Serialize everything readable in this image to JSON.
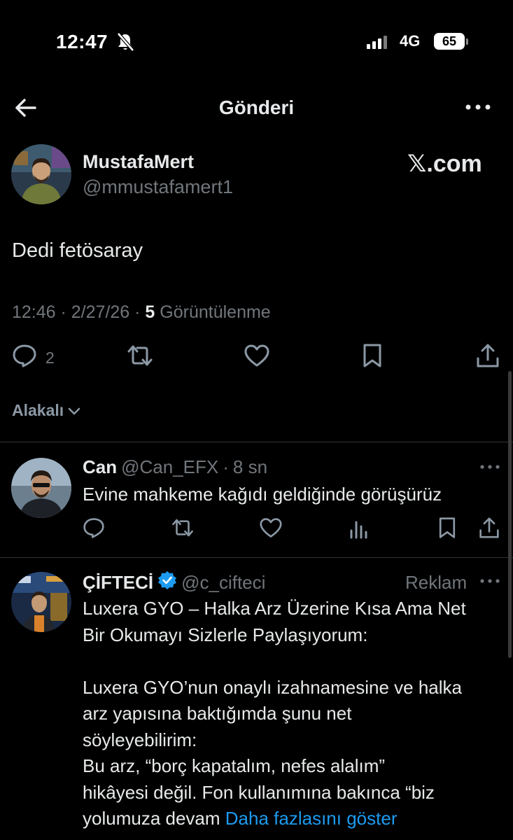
{
  "status_bar": {
    "time": "12:47",
    "network": "4G",
    "battery": "65"
  },
  "header": {
    "title": "Gönderi"
  },
  "post": {
    "author_name": "MustafaMert",
    "author_handle": "@mmustafamert1",
    "watermark": "𝕏.com",
    "text": "Dedi fetösaray",
    "time": "12:46",
    "date": "2/27/26",
    "view_count": "5",
    "view_label": "Görüntülenme",
    "reply_count": "2"
  },
  "sort": {
    "label": "Alakalı"
  },
  "replies": [
    {
      "name": "Can",
      "handle": "@Can_EFX",
      "time": "8 sn",
      "text": "Evine mahkeme kağıdı geldiğinde görüşürüz"
    },
    {
      "name": "ÇİFTECİ",
      "handle": "@c_cifteci",
      "ad_label": "Reklam",
      "text_lines": [
        "Luxera GYO – Halka Arz Üzerine Kısa Ama Net",
        "Bir Okumayı Sizlerle Paylaşıyorum:",
        "",
        "Luxera GYO’nun onaylı izahnamesine ve halka",
        "arz yapısına baktığımda şunu net",
        "söyleyebilirim:",
        "Bu arz, “borç kapatalım, nefes alalım”",
        "hikâyesi değil. Fon kullanımına bakınca “biz",
        "yolumuza devam"
      ],
      "show_more": "Daha fazlasını göster"
    }
  ],
  "colors": {
    "background": "#000000",
    "text_primary": "#e7e9ea",
    "text_secondary": "#71767b",
    "link": "#1d9bf0",
    "verified": "#1d9bf0",
    "divider": "#2f3336"
  }
}
